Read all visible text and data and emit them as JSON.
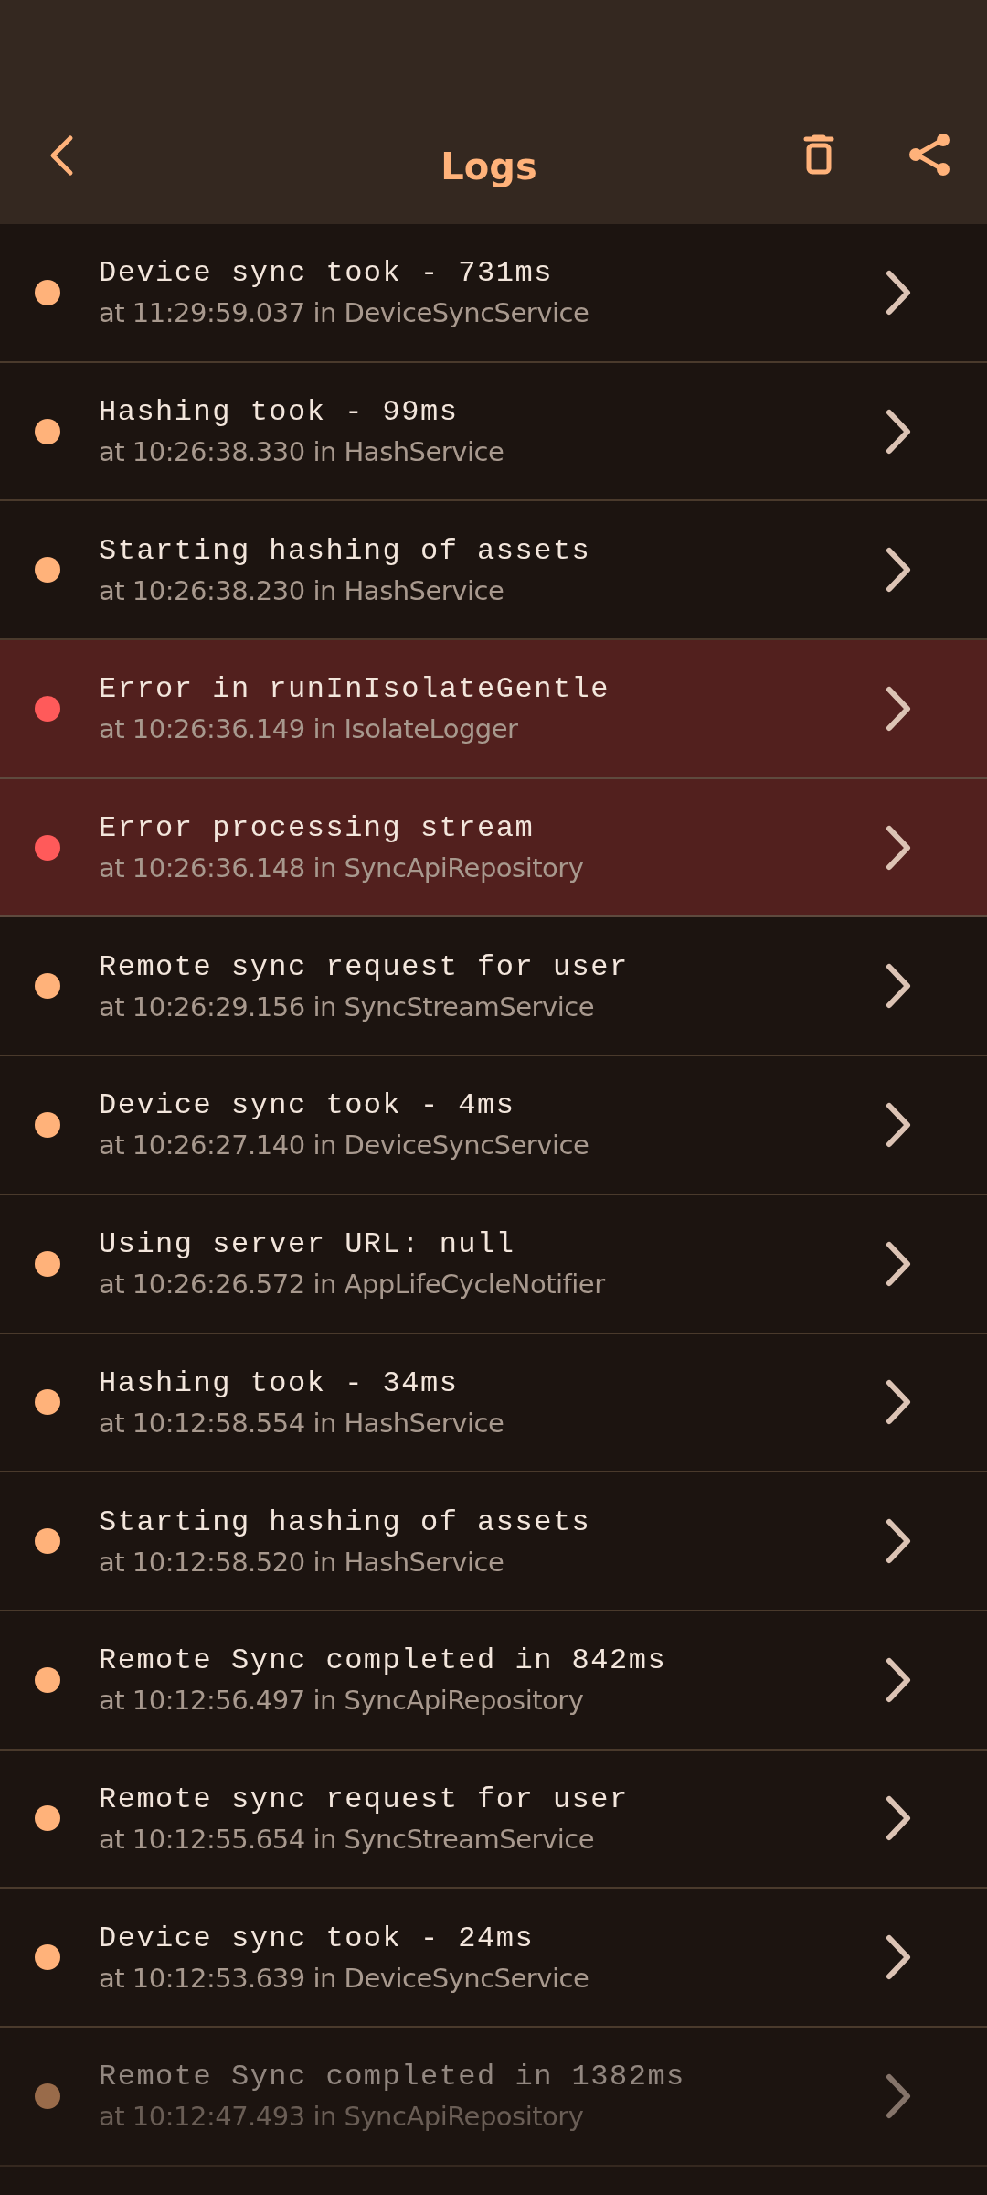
{
  "header": {
    "title": "Logs"
  },
  "logs": [
    {
      "message": "Device sync took - 731ms",
      "details": "at 11:29:59.037 in DeviceSyncService",
      "error": false
    },
    {
      "message": "Hashing took - 99ms",
      "details": "at 10:26:38.330 in HashService",
      "error": false
    },
    {
      "message": "Starting hashing of assets",
      "details": "at 10:26:38.230 in HashService",
      "error": false
    },
    {
      "message": "Error in runInIsolateGentle",
      "details": "at 10:26:36.149 in IsolateLogger",
      "error": true
    },
    {
      "message": "Error processing stream",
      "details": "at 10:26:36.148 in SyncApiRepository",
      "error": true
    },
    {
      "message": "Remote sync request for user",
      "details": "at 10:26:29.156 in SyncStreamService",
      "error": false
    },
    {
      "message": "Device sync took - 4ms",
      "details": "at 10:26:27.140 in DeviceSyncService",
      "error": false
    },
    {
      "message": "Using server URL: null",
      "details": "at 10:26:26.572 in AppLifeCycleNotifier",
      "error": false
    },
    {
      "message": "Hashing took - 34ms",
      "details": "at 10:12:58.554 in HashService",
      "error": false
    },
    {
      "message": "Starting hashing of assets",
      "details": "at 10:12:58.520 in HashService",
      "error": false
    },
    {
      "message": "Remote Sync completed in 842ms",
      "details": "at 10:12:56.497 in SyncApiRepository",
      "error": false
    },
    {
      "message": "Remote sync request for user",
      "details": "at 10:12:55.654 in SyncStreamService",
      "error": false
    },
    {
      "message": "Device sync took - 24ms",
      "details": "at 10:12:53.639 in DeviceSyncService",
      "error": false
    },
    {
      "message": "Remote Sync completed in 1382ms",
      "details": "at 10:12:47.493 in SyncApiRepository",
      "error": false,
      "faded": true
    }
  ]
}
